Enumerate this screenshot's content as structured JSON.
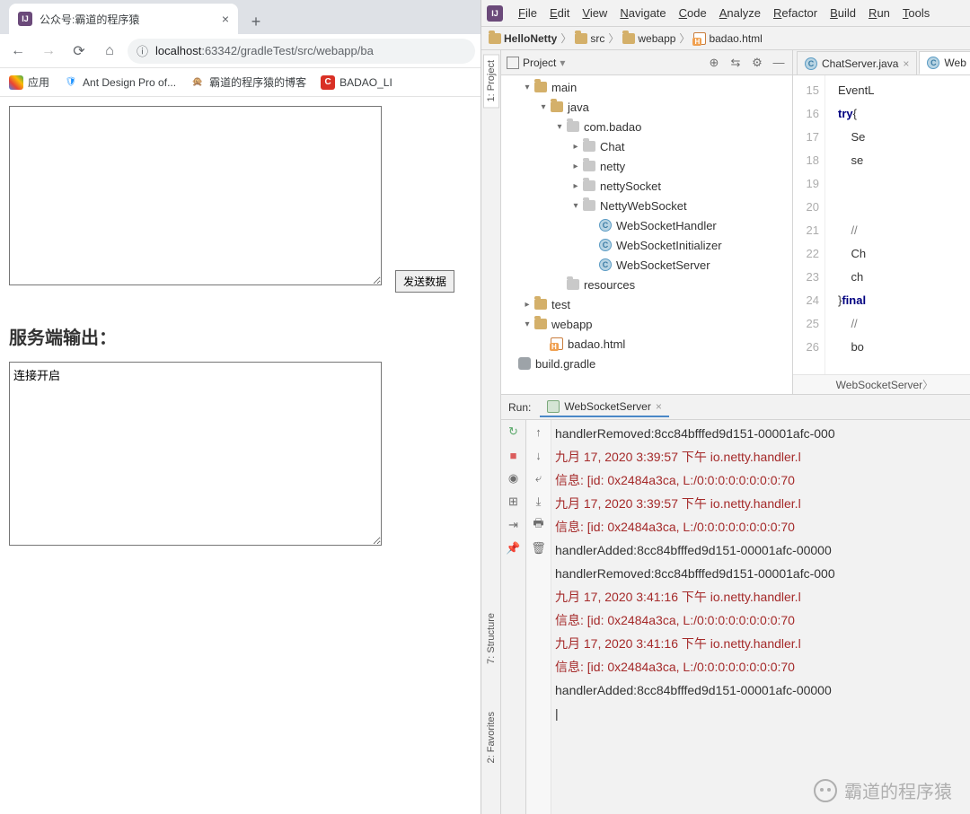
{
  "browser": {
    "tab_title": "公众号:霸道的程序猿",
    "url_host": "localhost",
    "url_rest": ":63342/gradleTest/src/webapp/ba",
    "bookmarks": {
      "apps": "应用",
      "ant": "Ant Design Pro of...",
      "blog": "霸道的程序猿的博客",
      "badao": "BADAO_LI"
    }
  },
  "page": {
    "send_button": "发送数据",
    "server_output_label": "服务端输出：",
    "response_text": "连接开启"
  },
  "ide": {
    "menu": [
      "File",
      "Edit",
      "View",
      "Navigate",
      "Code",
      "Analyze",
      "Refactor",
      "Build",
      "Run",
      "Tools"
    ],
    "breadcrumb": [
      "HelloNetty",
      "src",
      "webapp",
      "badao.html"
    ],
    "project_label": "Project",
    "tree": {
      "main": "main",
      "java": "java",
      "pkg": "com.badao",
      "chat": "Chat",
      "netty": "netty",
      "nettySocket": "nettySocket",
      "nettyWebSocket": "NettyWebSocket",
      "wsHandler": "WebSocketHandler",
      "wsInitializer": "WebSocketInitializer",
      "wsServer": "WebSocketServer",
      "resources": "resources",
      "test": "test",
      "webapp": "webapp",
      "badao": "badao.html",
      "build": "build.gradle"
    },
    "editor_tabs": {
      "chatServer": "ChatServer.java",
      "web": "Web"
    },
    "line_start": 15,
    "line_end": 26,
    "code_lines": [
      {
        "t": "EventL",
        "cls": ""
      },
      {
        "t": "try{",
        "cls": "kw"
      },
      {
        "t": "    Se",
        "cls": ""
      },
      {
        "t": "    se",
        "cls": ""
      },
      {
        "t": "",
        "cls": ""
      },
      {
        "t": "",
        "cls": ""
      },
      {
        "t": "    //",
        "cls": "cm"
      },
      {
        "t": "    Ch",
        "cls": ""
      },
      {
        "t": "    ch",
        "cls": ""
      },
      {
        "t": "}final",
        "cls": "kw"
      },
      {
        "t": "    //",
        "cls": "cm"
      },
      {
        "t": "    bo",
        "cls": ""
      }
    ],
    "code_crumb": "WebSocketServer",
    "run_label": "Run:",
    "run_tab": "WebSocketServer",
    "console": [
      {
        "t": "handlerRemoved:8cc84bfffed9d151-00001afc-000",
        "red": false
      },
      {
        "t": "九月 17, 2020 3:39:57 下午 io.netty.handler.l",
        "red": true
      },
      {
        "t": "信息: [id: 0x2484a3ca, L:/0:0:0:0:0:0:0:0:70",
        "red": true
      },
      {
        "t": "九月 17, 2020 3:39:57 下午 io.netty.handler.l",
        "red": true
      },
      {
        "t": "信息: [id: 0x2484a3ca, L:/0:0:0:0:0:0:0:0:70",
        "red": true
      },
      {
        "t": "handlerAdded:8cc84bfffed9d151-00001afc-00000",
        "red": false
      },
      {
        "t": "handlerRemoved:8cc84bfffed9d151-00001afc-000",
        "red": false
      },
      {
        "t": "九月 17, 2020 3:41:16 下午 io.netty.handler.l",
        "red": true
      },
      {
        "t": "信息: [id: 0x2484a3ca, L:/0:0:0:0:0:0:0:0:70",
        "red": true
      },
      {
        "t": "九月 17, 2020 3:41:16 下午 io.netty.handler.l",
        "red": true
      },
      {
        "t": "信息: [id: 0x2484a3ca, L:/0:0:0:0:0:0:0:0:70",
        "red": true
      },
      {
        "t": "handlerAdded:8cc84bfffed9d151-00001afc-00000",
        "red": false
      }
    ],
    "side_tabs": {
      "project": "1: Project",
      "structure": "7: Structure",
      "favorites": "2: Favorites"
    }
  },
  "watermark": "霸道的程序猿"
}
